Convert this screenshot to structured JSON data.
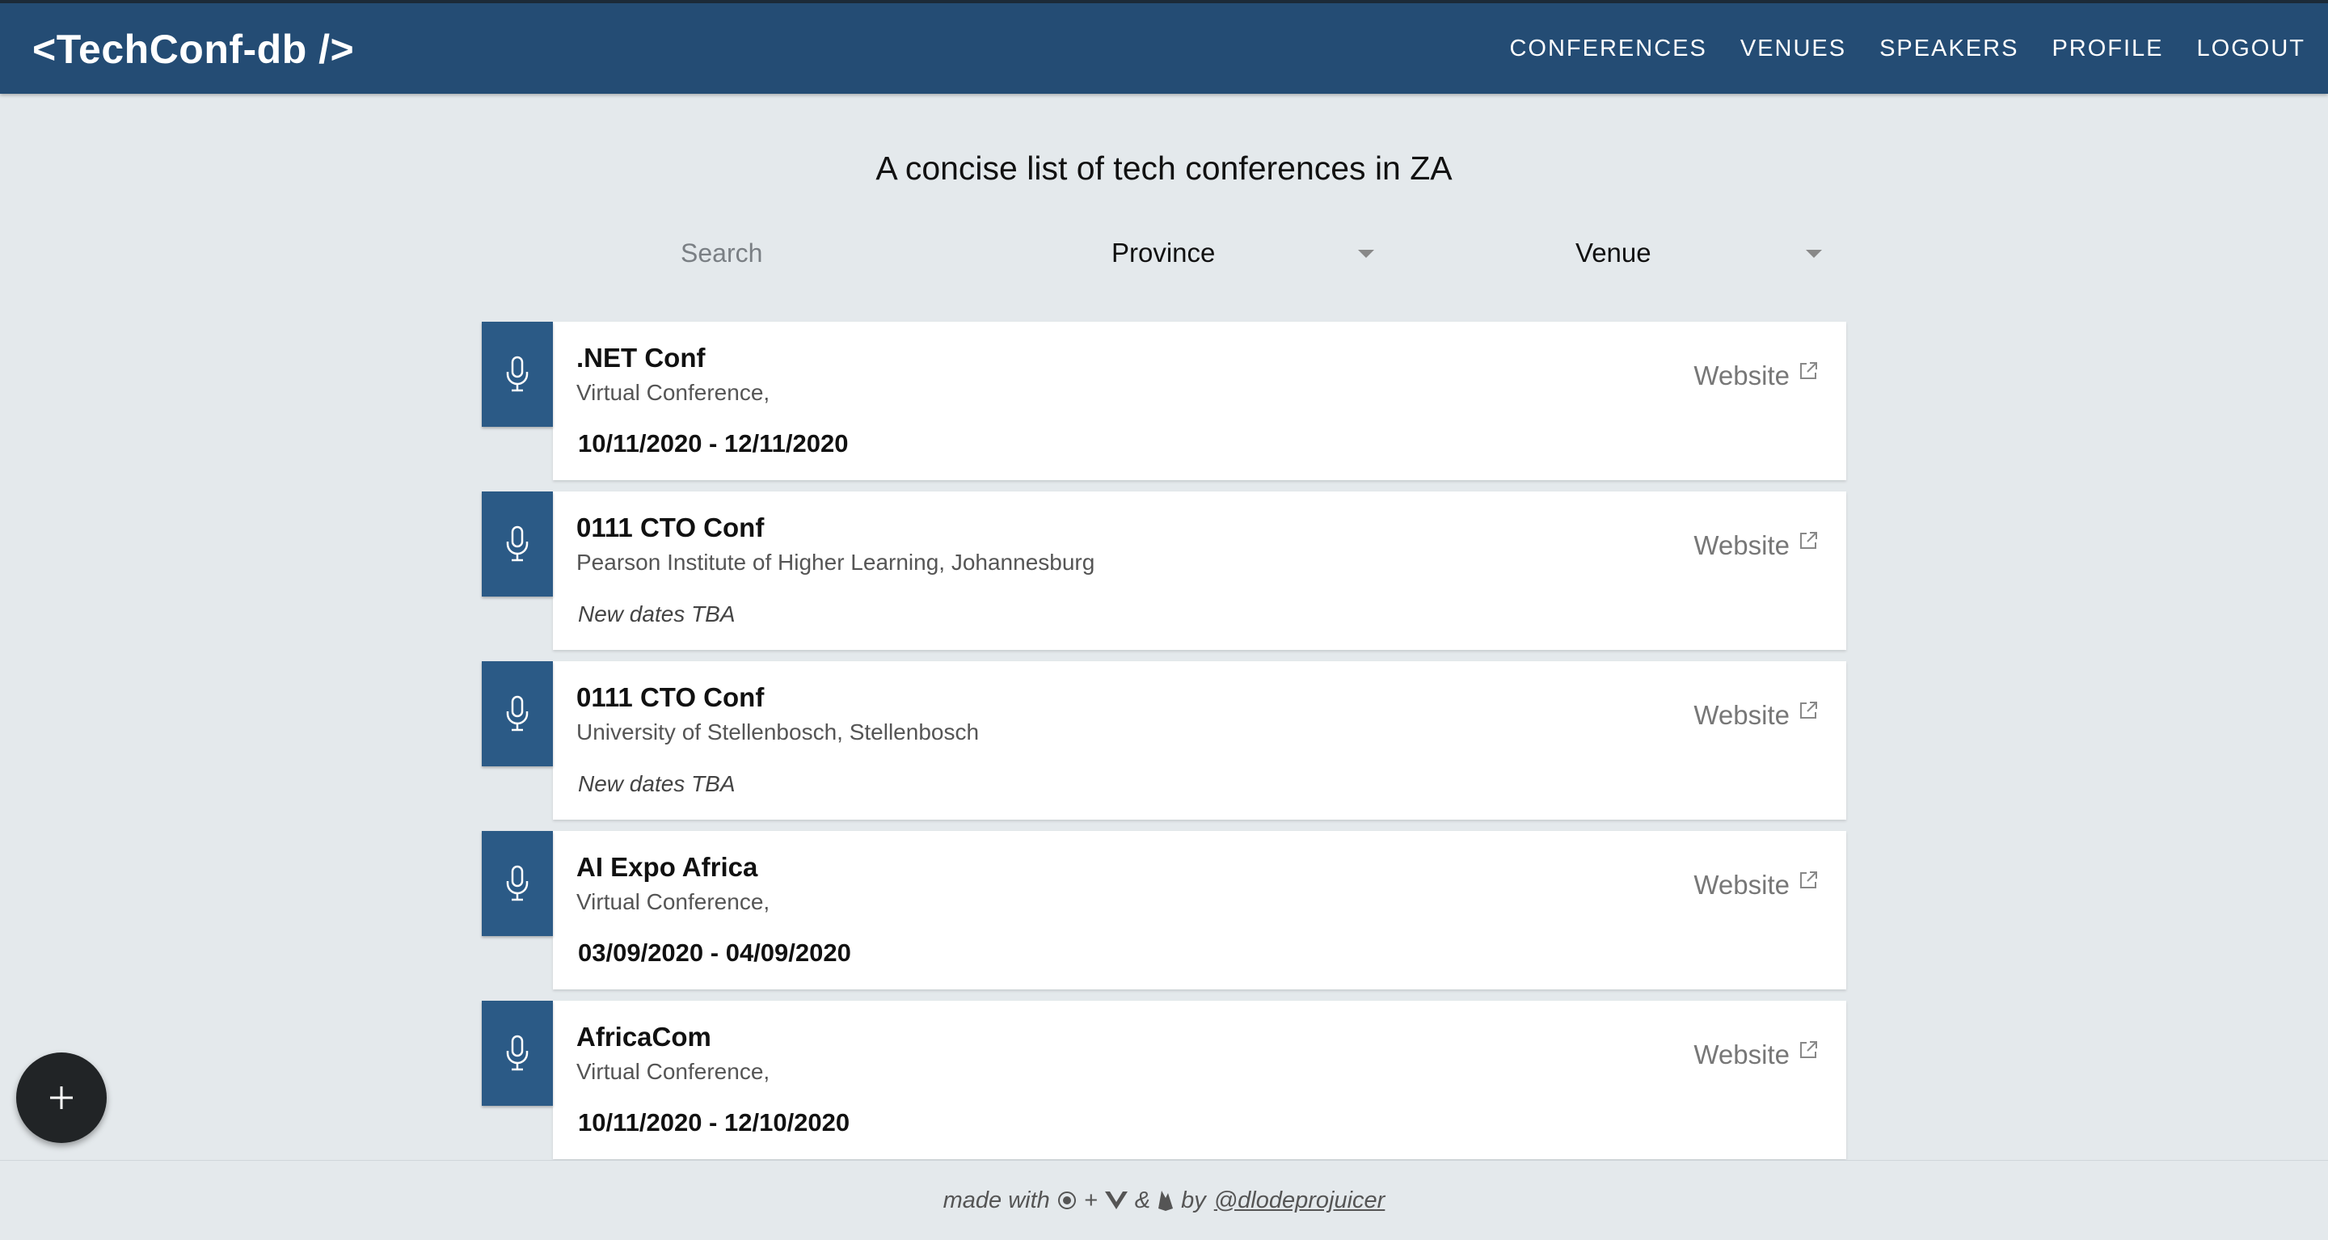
{
  "header": {
    "brand": "<TechConf-db />",
    "nav": [
      "CONFERENCES",
      "VENUES",
      "SPEAKERS",
      "PROFILE",
      "LOGOUT"
    ]
  },
  "page": {
    "title": "A concise list of tech conferences in ZA"
  },
  "filters": {
    "search_placeholder": "Search",
    "province": "Province",
    "venue": "Venue"
  },
  "conferences": [
    {
      "name": ".NET Conf",
      "venue": "Virtual Conference,",
      "dates": "10/11/2020 - 12/11/2020",
      "website": "Website"
    },
    {
      "name": "0111 CTO Conf",
      "venue": "Pearson Institute of Higher Learning, Johannesburg",
      "dates": "New dates TBA",
      "website": "Website"
    },
    {
      "name": "0111 CTO Conf",
      "venue": "University of Stellenbosch, Stellenbosch",
      "dates": "New dates TBA",
      "website": "Website"
    },
    {
      "name": "AI Expo Africa",
      "venue": "Virtual Conference,",
      "dates": "03/09/2020 - 04/09/2020",
      "website": "Website"
    },
    {
      "name": "AfricaCom",
      "venue": "Virtual Conference,",
      "dates": "10/11/2020 - 12/10/2020",
      "website": "Website"
    }
  ],
  "footer": {
    "made_with": "made with",
    "plus": "+",
    "amp": "&",
    "by": "by",
    "author": "@dlodeprojuicer"
  },
  "colors": {
    "header_bg": "#244c74",
    "icon_bg": "#2b5a86",
    "page_bg": "#e4e9ec",
    "fab_bg": "#212426"
  },
  "icons": {
    "card": "microphone-icon",
    "website": "external-link-icon",
    "fab": "plus-icon"
  }
}
